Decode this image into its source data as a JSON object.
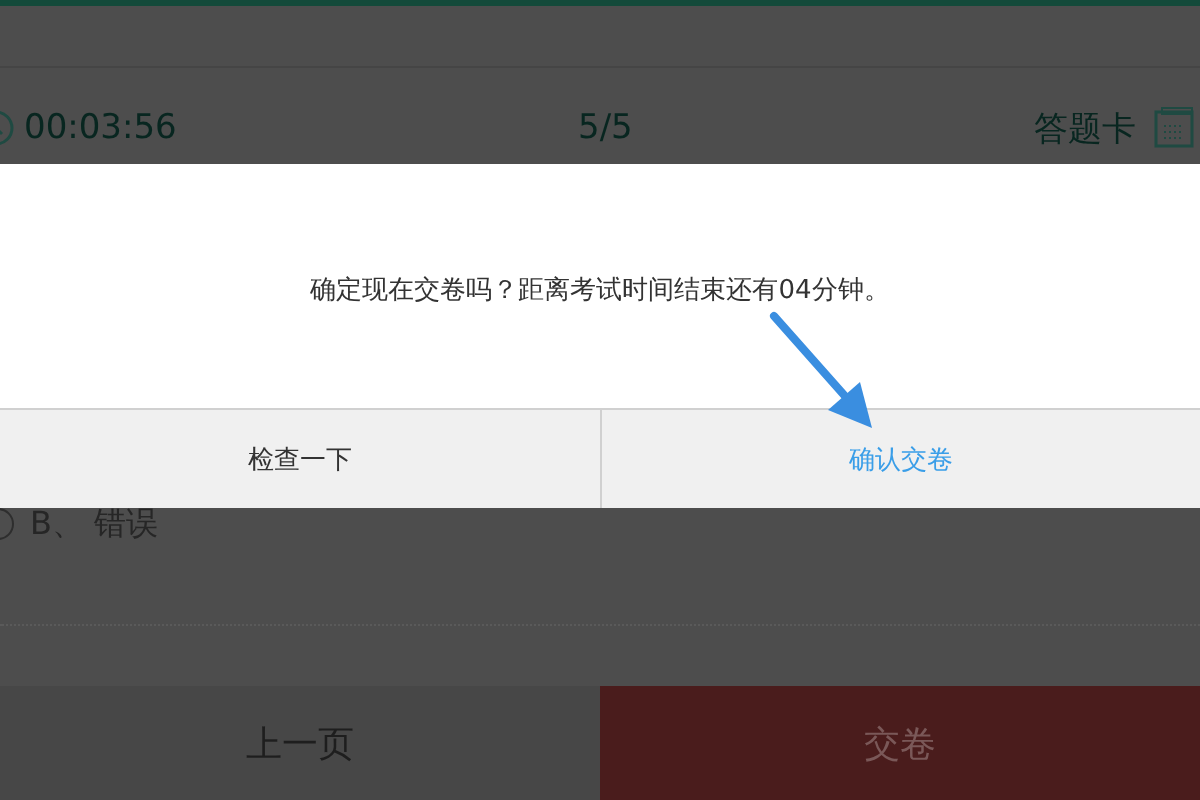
{
  "toolbar": {
    "timer": "00:03:56",
    "progress": "5/5",
    "answer_card": "答题卡"
  },
  "options": [
    {
      "label": "B、 错误",
      "selected": false
    }
  ],
  "footer": {
    "prev": "上一页",
    "submit": "交卷"
  },
  "dialog": {
    "message": "确定现在交卷吗？距离考试时间结束还有04分钟。",
    "buttons": [
      {
        "label": "检查一下",
        "kind": "secondary"
      },
      {
        "label": "确认交卷",
        "kind": "primary"
      }
    ]
  }
}
